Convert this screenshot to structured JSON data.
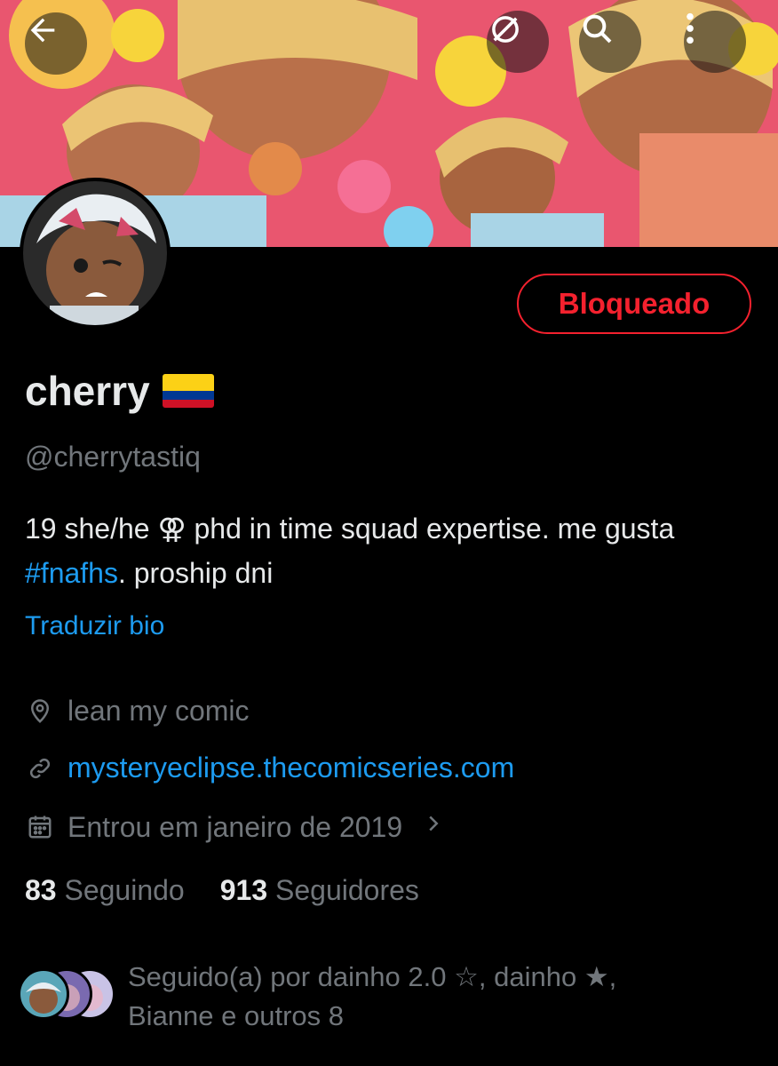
{
  "header": {
    "back_icon": "arrow-left-icon",
    "grok_icon": "grok-icon",
    "search_icon": "search-icon",
    "more_icon": "more-vertical-icon"
  },
  "profile": {
    "blocked_label": "Bloqueado",
    "display_name": "cherry",
    "flag_emoji": "🇨🇴",
    "handle": "@cherrytastiq",
    "bio_part1": "19 she/he ⚢ phd in time squad expertise. me gusta ",
    "bio_hashtag": "#fnafhs",
    "bio_part2": ". proship dni",
    "translate_label": "Traduzir bio",
    "location": "lean my comic",
    "website": "mysteryeclipse.thecomicseries.com",
    "joined": "Entrou em janeiro de 2019",
    "following_count": "83",
    "following_label": "Seguindo",
    "followers_count": "913",
    "followers_label": "Seguidores",
    "followed_by_line1": "Seguido(a) por dainho 2.0 ☆, dainho ★,",
    "followed_by_line2": "Bianne e outros 8"
  },
  "colors": {
    "accent": "#1d9bf0",
    "danger": "#f4212e",
    "muted": "#71767b",
    "text": "#e7e9ea",
    "background": "#000000"
  }
}
